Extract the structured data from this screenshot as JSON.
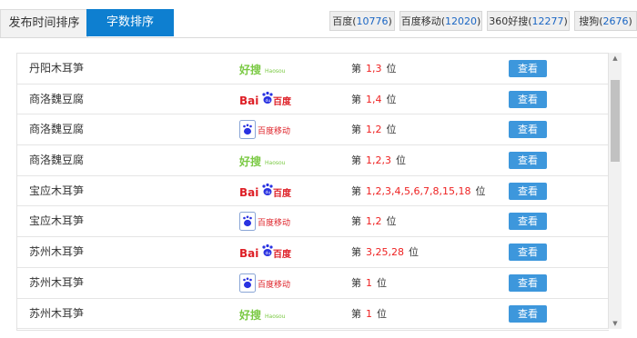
{
  "tabs": [
    {
      "label": "发布时间排序",
      "active": false
    },
    {
      "label": "字数排序",
      "active": true
    }
  ],
  "engines": [
    {
      "name": "百度",
      "count": "10776"
    },
    {
      "name": "百度移动",
      "count": "12020"
    },
    {
      "name": "360好搜",
      "count": "12277"
    },
    {
      "name": "搜狗",
      "count": "2676"
    }
  ],
  "rank_prefix": "第",
  "rank_suffix": "位",
  "view_label": "查看",
  "logo_text": {
    "haosou": "好搜",
    "haosou_sub": "Haosou",
    "baidu_bai": "Bai",
    "baidu_du": "du",
    "baidu_cn": "百度",
    "baidu_mobile": "百度移动"
  },
  "rows": [
    {
      "keyword": "丹阳木耳笋",
      "engine": "haosou",
      "positions": "1,3"
    },
    {
      "keyword": "商洛魏豆腐",
      "engine": "baidu",
      "positions": "1,4"
    },
    {
      "keyword": "商洛魏豆腐",
      "engine": "baidu-mobile",
      "positions": "1,2"
    },
    {
      "keyword": "商洛魏豆腐",
      "engine": "haosou",
      "positions": "1,2,3"
    },
    {
      "keyword": "宝应木耳笋",
      "engine": "baidu",
      "positions": "1,2,3,4,5,6,7,8,15,18"
    },
    {
      "keyword": "宝应木耳笋",
      "engine": "baidu-mobile",
      "positions": "1,2"
    },
    {
      "keyword": "苏州木耳笋",
      "engine": "baidu",
      "positions": "3,25,28"
    },
    {
      "keyword": "苏州木耳笋",
      "engine": "baidu-mobile",
      "positions": "1"
    },
    {
      "keyword": "苏州木耳笋",
      "engine": "haosou",
      "positions": "1"
    }
  ],
  "colors": {
    "tab_active_bg": "#0e7fd0",
    "button_bg": "#3d97dc",
    "rank_highlight": "#e22222",
    "count_text": "#1a66c4",
    "haosou_green": "#7ac943",
    "baidu_red": "#de1f26",
    "baidu_blue": "#2932e1"
  }
}
